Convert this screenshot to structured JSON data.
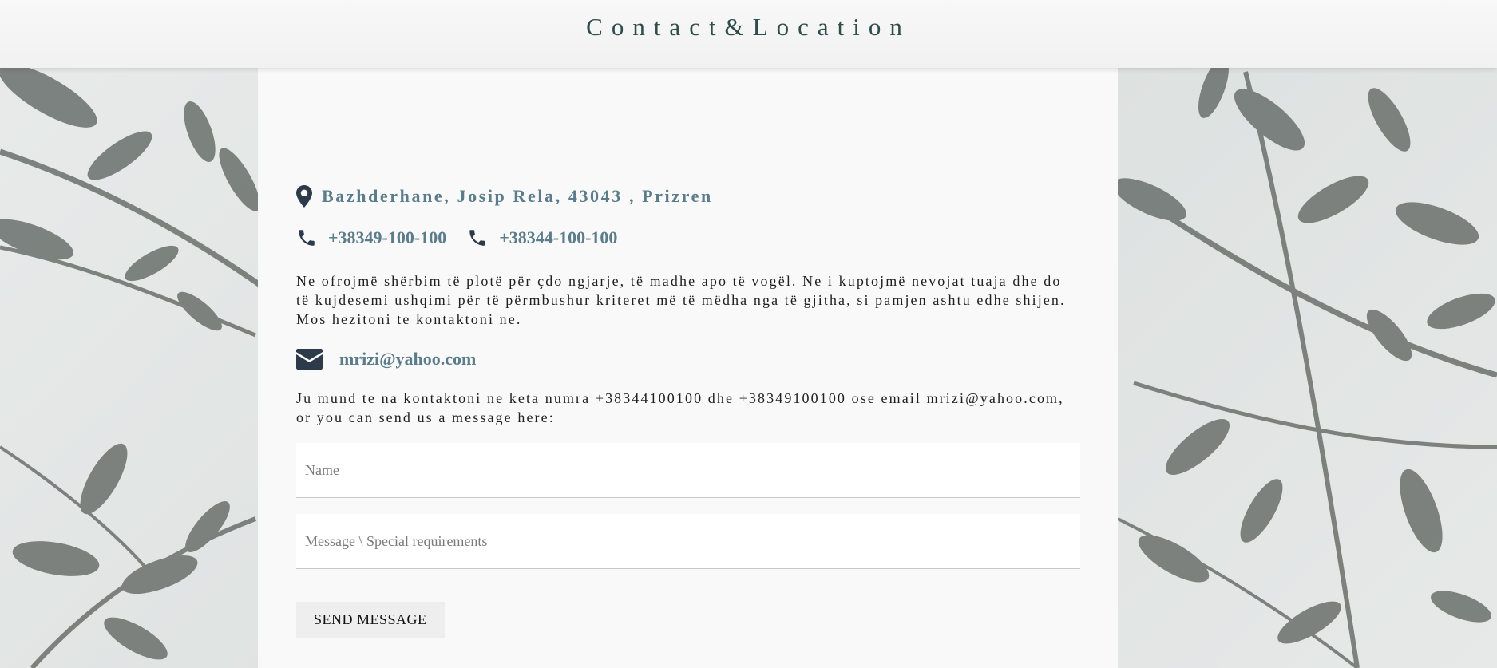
{
  "header": {
    "title": "Contact&Location"
  },
  "contact": {
    "address": "Bazhderhane, Josip Rela, 43043 , Prizren",
    "phones": [
      "+38349-100-100",
      "+38344-100-100"
    ],
    "description": "Ne ofrojmë shërbim të plotë për çdo ngjarje, të madhe apo të vogël. Ne i kuptojmë nevojat tuaja dhe do të kujdesemi ushqimi për të përmbushur kriteret më të mëdha nga të gjitha, si pamjen ashtu edhe shijen. Mos hezitoni te kontaktoni ne.",
    "email": "mrizi@yahoo.com",
    "note": "Ju mund te na kontaktoni ne keta numra +38344100100 dhe +38349100100 ose email mrizi@yahoo.com, or you can send us a message here:"
  },
  "form": {
    "name_placeholder": "Name",
    "message_placeholder": "Message \\ Special requirements",
    "send_label": "SEND MESSAGE"
  },
  "icons": {
    "address": "map-pin-icon",
    "phone": "phone-icon",
    "email": "envelope-icon"
  },
  "colors": {
    "accent": "#5b7c8a",
    "title": "#2e4c4a",
    "icon": "#2d3a4a"
  }
}
